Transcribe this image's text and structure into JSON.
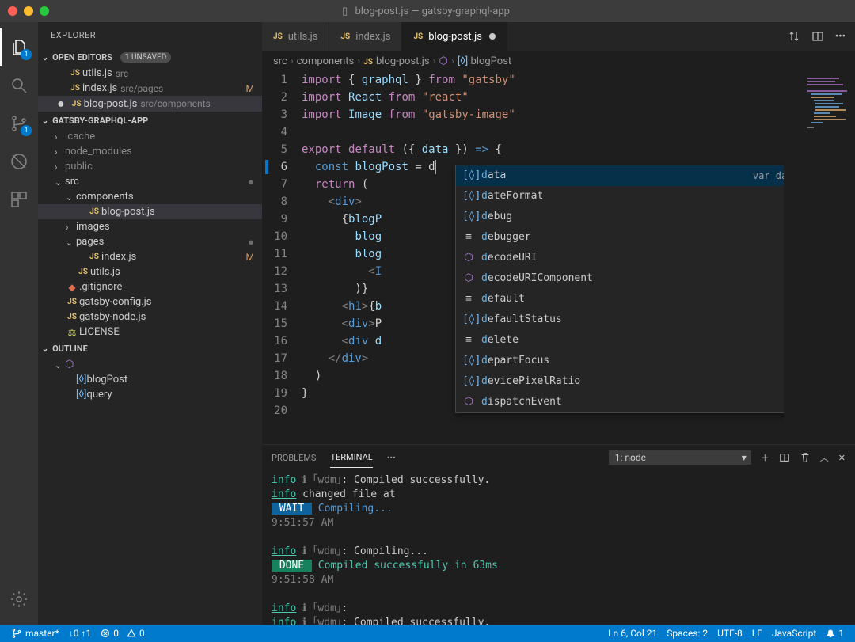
{
  "titlebar": {
    "filename": "blog-post.js",
    "project": "gatsby-graphql-app"
  },
  "activity": {
    "explorer_badge": "1",
    "scm_badge": "1"
  },
  "sidebar": {
    "title": "EXPLORER",
    "openEditors": {
      "label": "OPEN EDITORS",
      "unsaved": "1 UNSAVED",
      "items": [
        {
          "name": "utils.js",
          "path": "src",
          "modified": ""
        },
        {
          "name": "index.js",
          "path": "src/pages",
          "modified": "M"
        },
        {
          "name": "blog-post.js",
          "path": "src/components",
          "modified": "●",
          "selected": true
        }
      ]
    },
    "workspace": {
      "label": "GATSBY-GRAPHQL-APP",
      "tree": [
        {
          "indent": 1,
          "chev": "›",
          "name": ".cache",
          "dim": true
        },
        {
          "indent": 1,
          "chev": "›",
          "name": "node_modules",
          "dim": true
        },
        {
          "indent": 1,
          "chev": "›",
          "name": "public",
          "dim": true
        },
        {
          "indent": 1,
          "chev": "⌄",
          "name": "src",
          "status": "●"
        },
        {
          "indent": 2,
          "chev": "⌄",
          "name": "components"
        },
        {
          "indent": 3,
          "chev": "",
          "icon": "JS",
          "name": "blog-post.js",
          "selected": true
        },
        {
          "indent": 2,
          "chev": "›",
          "name": "images"
        },
        {
          "indent": 2,
          "chev": "⌄",
          "name": "pages",
          "status": "●"
        },
        {
          "indent": 3,
          "chev": "",
          "icon": "JS",
          "name": "index.js",
          "status": "M"
        },
        {
          "indent": 2,
          "chev": "",
          "icon": "JS",
          "name": "utils.js"
        },
        {
          "indent": 1,
          "chev": "",
          "icon": "GIT",
          "name": ".gitignore"
        },
        {
          "indent": 1,
          "chev": "",
          "icon": "JS",
          "name": "gatsby-config.js"
        },
        {
          "indent": 1,
          "chev": "",
          "icon": "JS",
          "name": "gatsby-node.js"
        },
        {
          "indent": 1,
          "chev": "",
          "icon": "LIC",
          "name": "LICENSE"
        }
      ]
    },
    "outline": {
      "label": "OUTLINE",
      "items": [
        {
          "indent": 1,
          "chev": "⌄",
          "icon": "cube",
          "name": "<function>"
        },
        {
          "indent": 2,
          "chev": "",
          "icon": "var",
          "name": "blogPost"
        },
        {
          "indent": 2,
          "chev": "",
          "icon": "var",
          "name": "query"
        }
      ]
    }
  },
  "tabs": [
    {
      "name": "utils.js"
    },
    {
      "name": "index.js"
    },
    {
      "name": "blog-post.js",
      "active": true,
      "dirty": true
    }
  ],
  "breadcrumbs": [
    "src",
    "components",
    "blog-post.js",
    "<function>",
    "blogPost"
  ],
  "suggestions": {
    "detail": "var data: any",
    "items": [
      {
        "icon": "var",
        "match": "d",
        "rest": "ata",
        "selected": true
      },
      {
        "icon": "var",
        "match": "d",
        "rest": "ateFormat"
      },
      {
        "icon": "var",
        "match": "d",
        "rest": "ebug"
      },
      {
        "icon": "kw",
        "match": "d",
        "rest": "ebugger"
      },
      {
        "icon": "method",
        "match": "d",
        "rest": "ecodeURI"
      },
      {
        "icon": "method",
        "match": "d",
        "rest": "ecodeURIComponent"
      },
      {
        "icon": "kw",
        "match": "d",
        "rest": "efault"
      },
      {
        "icon": "var",
        "match": "d",
        "rest": "efaultStatus"
      },
      {
        "icon": "kw",
        "match": "d",
        "rest": "elete"
      },
      {
        "icon": "var",
        "match": "d",
        "rest": "epartFocus"
      },
      {
        "icon": "var",
        "match": "d",
        "rest": "evicePixelRatio"
      },
      {
        "icon": "method",
        "match": "d",
        "rest": "ispatchEvent"
      }
    ]
  },
  "panel": {
    "tabs": {
      "problems": "PROBLEMS",
      "terminal": "TERMINAL"
    },
    "dropdown": "1: node",
    "lines": [
      {
        "segs": [
          {
            "cls": "t-info t-under",
            "t": "info"
          },
          {
            "cls": "t-dim",
            "t": " ℹ "
          },
          {
            "cls": "t-dim",
            "t": "｢wdm｣"
          },
          {
            "t": ": Compiled successfully."
          }
        ]
      },
      {
        "segs": [
          {
            "cls": "t-info t-under",
            "t": "info"
          },
          {
            "t": " changed file at"
          }
        ]
      },
      {
        "segs": [
          {
            "cls": "t-waitbg",
            "t": " WAIT "
          },
          {
            "cls": "t-blue",
            "t": " Compiling..."
          }
        ]
      },
      {
        "segs": [
          {
            "cls": "t-dim",
            "t": "9:51:57 AM"
          }
        ]
      },
      {
        "segs": [
          {
            "t": " "
          }
        ]
      },
      {
        "segs": [
          {
            "cls": "t-info t-under",
            "t": "info"
          },
          {
            "cls": "t-dim",
            "t": " ℹ "
          },
          {
            "cls": "t-dim",
            "t": "｢wdm｣"
          },
          {
            "t": ": Compiling..."
          }
        ]
      },
      {
        "segs": [
          {
            "cls": "t-donebg",
            "t": " DONE "
          },
          {
            "cls": "t-info",
            "t": " Compiled successfully in 63ms"
          }
        ]
      },
      {
        "segs": [
          {
            "cls": "t-dim",
            "t": "9:51:58 AM"
          }
        ]
      },
      {
        "segs": [
          {
            "t": " "
          }
        ]
      },
      {
        "segs": [
          {
            "cls": "t-info t-under",
            "t": "info"
          },
          {
            "cls": "t-dim",
            "t": " ℹ "
          },
          {
            "cls": "t-dim",
            "t": "｢wdm｣"
          },
          {
            "t": ":"
          }
        ]
      },
      {
        "segs": [
          {
            "cls": "t-info t-under",
            "t": "info"
          },
          {
            "cls": "t-dim",
            "t": " ℹ "
          },
          {
            "cls": "t-dim",
            "t": "｢wdm｣"
          },
          {
            "t": ": Compiled successfully."
          }
        ]
      }
    ]
  },
  "statusbar": {
    "branch": "master*",
    "sync": "↓0 ↑1",
    "errors": "0",
    "warnings": "0",
    "lncol": "Ln 6, Col 21",
    "spaces": "Spaces: 2",
    "encoding": "UTF-8",
    "eol": "LF",
    "lang": "JavaScript",
    "bell": "1"
  },
  "code": [
    [
      {
        "t": "import",
        "c": "kw"
      },
      {
        "t": " { "
      },
      {
        "t": "graphql",
        "c": "var"
      },
      {
        "t": " } "
      },
      {
        "t": "from",
        "c": "kw"
      },
      {
        "t": " "
      },
      {
        "t": "\"gatsby\"",
        "c": "str"
      }
    ],
    [
      {
        "t": "import",
        "c": "kw"
      },
      {
        "t": " "
      },
      {
        "t": "React",
        "c": "var"
      },
      {
        "t": " "
      },
      {
        "t": "from",
        "c": "kw"
      },
      {
        "t": " "
      },
      {
        "t": "\"react\"",
        "c": "str"
      }
    ],
    [
      {
        "t": "import",
        "c": "kw"
      },
      {
        "t": " "
      },
      {
        "t": "Image",
        "c": "var"
      },
      {
        "t": " "
      },
      {
        "t": "from",
        "c": "kw"
      },
      {
        "t": " "
      },
      {
        "t": "\"gatsby-image\"",
        "c": "str"
      }
    ],
    [],
    [
      {
        "t": "export",
        "c": "kw"
      },
      {
        "t": " "
      },
      {
        "t": "default",
        "c": "kw"
      },
      {
        "t": " ({ "
      },
      {
        "t": "data",
        "c": "var"
      },
      {
        "t": " }) "
      },
      {
        "t": "=>",
        "c": "kw2"
      },
      {
        "t": " {"
      }
    ],
    [
      {
        "t": "  "
      },
      {
        "t": "const",
        "c": "kw2"
      },
      {
        "t": " "
      },
      {
        "t": "blogPost",
        "c": "var"
      },
      {
        "t": " = d"
      }
    ],
    [
      {
        "t": "  "
      },
      {
        "t": "return",
        "c": "kw"
      },
      {
        "t": " ("
      }
    ],
    [
      {
        "t": "    "
      },
      {
        "t": "<",
        "c": "tag"
      },
      {
        "t": "div",
        "c": "tagn"
      },
      {
        "t": ">",
        "c": "tag"
      }
    ],
    [
      {
        "t": "      {"
      },
      {
        "t": "blogP",
        "c": "var"
      }
    ],
    [
      {
        "t": "        "
      },
      {
        "t": "blog",
        "c": "var"
      }
    ],
    [
      {
        "t": "        "
      },
      {
        "t": "blog",
        "c": "var"
      }
    ],
    [
      {
        "t": "          "
      },
      {
        "t": "<",
        "c": "tag"
      },
      {
        "t": "I",
        "c": "tagn"
      }
    ],
    [
      {
        "t": "        )}"
      }
    ],
    [
      {
        "t": "      "
      },
      {
        "t": "<",
        "c": "tag"
      },
      {
        "t": "h1",
        "c": "tagn"
      },
      {
        "t": ">",
        "c": "tag"
      },
      {
        "t": "{"
      },
      {
        "t": "b",
        "c": "var"
      }
    ],
    [
      {
        "t": "      "
      },
      {
        "t": "<",
        "c": "tag"
      },
      {
        "t": "div",
        "c": "tagn"
      },
      {
        "t": ">",
        "c": "tag"
      },
      {
        "t": "P"
      }
    ],
    [
      {
        "t": "      "
      },
      {
        "t": "<",
        "c": "tag"
      },
      {
        "t": "div",
        "c": "tagn"
      },
      {
        "t": " "
      },
      {
        "t": "d",
        "c": "var"
      }
    ],
    [
      {
        "t": "    "
      },
      {
        "t": "</",
        "c": "tag"
      },
      {
        "t": "div",
        "c": "tagn"
      },
      {
        "t": ">",
        "c": "tag"
      }
    ],
    [
      {
        "t": "  )"
      }
    ],
    [
      {
        "t": "}"
      }
    ],
    []
  ]
}
